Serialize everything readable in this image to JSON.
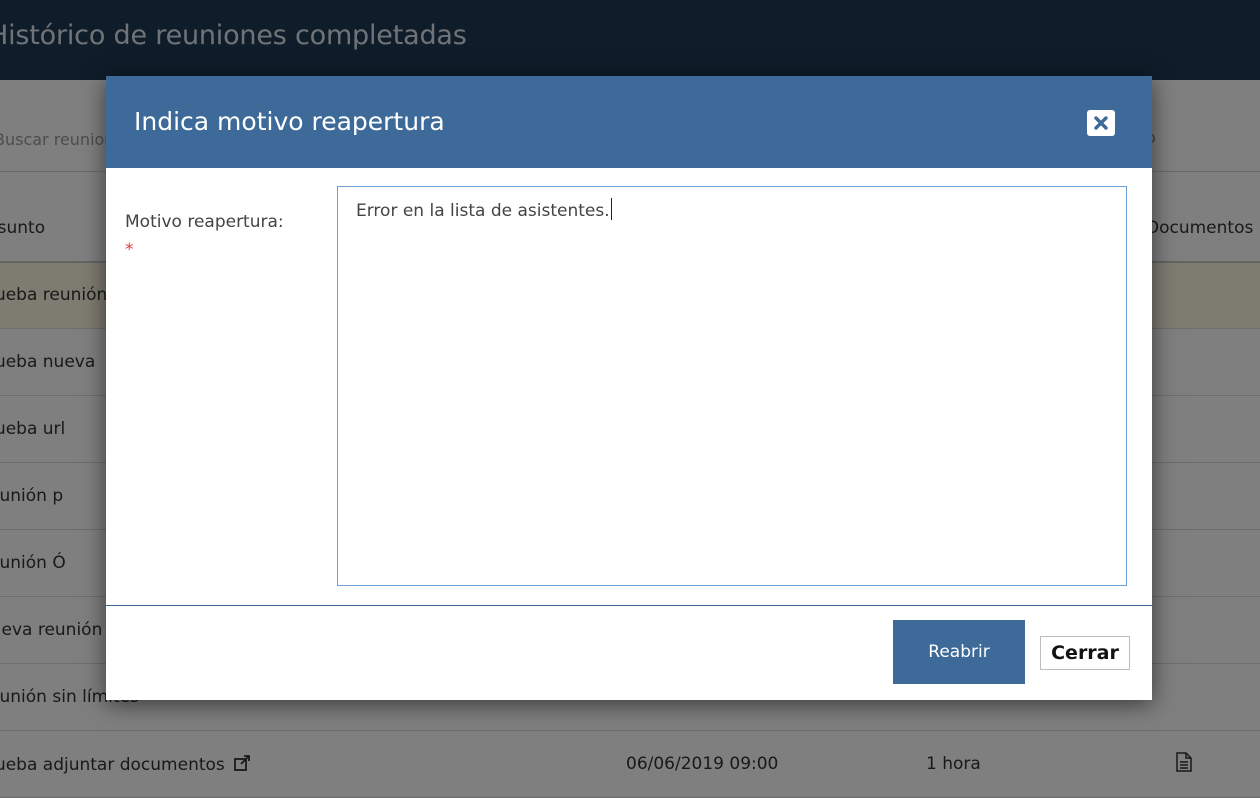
{
  "page": {
    "title": "Histórico de reuniones completadas",
    "search_placeholder": "Buscar reuniones",
    "search_right_text": "o"
  },
  "table": {
    "columns": {
      "asunto": "Asunto",
      "documentos": "Documentos"
    },
    "rows": [
      {
        "asunto": "Prueba reunión",
        "fecha": "",
        "duracion": ""
      },
      {
        "asunto": "Prueba nueva",
        "fecha": "",
        "duracion": ""
      },
      {
        "asunto": "Prueba url",
        "fecha": "",
        "duracion": ""
      },
      {
        "asunto": "Reunión p",
        "fecha": "",
        "duracion": ""
      },
      {
        "asunto": "Reunión Ó",
        "fecha": "",
        "duracion": ""
      },
      {
        "asunto": "Nueva reunión",
        "fecha": "",
        "duracion": ""
      },
      {
        "asunto": "Reunión sin límites",
        "fecha": "",
        "duracion": ""
      },
      {
        "asunto": "Prueba adjuntar documentos",
        "fecha": "06/06/2019 09:00",
        "duracion": "1 hora"
      }
    ]
  },
  "modal": {
    "title": "Indica motivo reapertura",
    "field_label": "Motivo reapertura:",
    "required_mark": "*",
    "textarea_value": "Error en la lista de asistentes.",
    "submit_label": "Reabrir",
    "close_label": "Cerrar"
  },
  "icons": {
    "close": "close-icon",
    "external_link": "external-link-icon",
    "document": "document-icon"
  },
  "colors": {
    "topbar": "#1e3953",
    "modal_header": "#3d6a99",
    "primary_button": "#3d6a99",
    "required": "#e03c3c",
    "row_highlight": "#fcf8e3"
  }
}
